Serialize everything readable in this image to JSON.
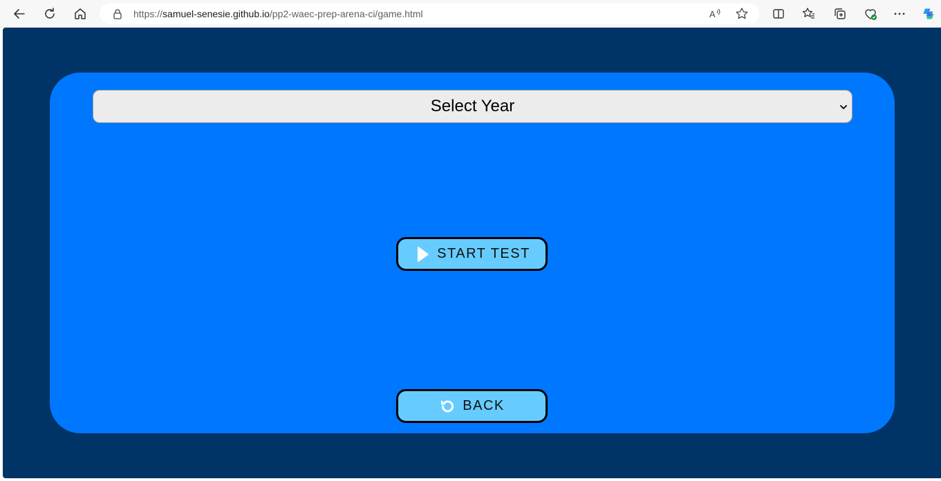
{
  "browser": {
    "url_prefix": "https://",
    "url_host": "samuel-senesie.github.io",
    "url_path": "/pp2-waec-prep-arena-ci/game.html",
    "icons": [
      "back-arrow-icon",
      "refresh-icon",
      "home-icon",
      "lock-icon",
      "read-aloud-icon",
      "favorite-star-icon",
      "split-screen-icon",
      "favorites-icon",
      "collections-icon",
      "browser-essentials-icon",
      "more-icon",
      "copilot-icon"
    ]
  },
  "game": {
    "year_select": {
      "selected": "Select Year"
    },
    "start_button": {
      "label": "START TEST",
      "icon": "play-icon"
    },
    "back_button": {
      "label": "BACK",
      "icon": "undo-icon"
    }
  },
  "colors": {
    "page_background": "#003366",
    "card_background": "#0077ff",
    "button_background": "#66ccff",
    "select_background": "#ececec"
  }
}
